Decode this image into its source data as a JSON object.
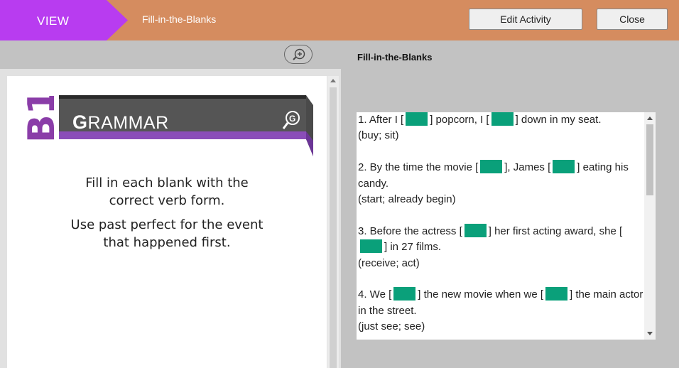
{
  "header": {
    "view_label": "VIEW",
    "activity_title": "Fill-in-the-Blanks",
    "edit_label": "Edit Activity",
    "close_label": "Close",
    "colors": {
      "bar": "#d58c5f",
      "view_tab": "#b83cf0"
    }
  },
  "preview": {
    "zoom_icon": "zoom-in-icon",
    "level_badge": "B1",
    "banner_title": "GRAMMAR",
    "banner_icon": "grammar-search-icon",
    "instruction_1": [
      "Fill in each blank with the",
      "correct verb form."
    ],
    "instruction_2": [
      "Use past perfect for the event",
      "that happened first."
    ]
  },
  "activity": {
    "title": "Fill-in-the-Blanks",
    "blank_color": "#0aa07a",
    "questions": [
      {
        "segments": [
          "1. After I [",
          "] popcorn, I [",
          "] down in my seat."
        ],
        "hint": "(buy; sit)"
      },
      {
        "segments": [
          "2. By the time the movie [",
          "], James [",
          "] eating his candy."
        ],
        "hint": "(start; already begin)"
      },
      {
        "segments": [
          "3. Before the actress [",
          "] her first acting award, she [",
          "] in 27 films."
        ],
        "hint": "(receive; act)"
      },
      {
        "segments": [
          "4. We [",
          "] the new movie when we [",
          "] the main actor in the street."
        ],
        "hint": "(just see; see)"
      }
    ]
  }
}
